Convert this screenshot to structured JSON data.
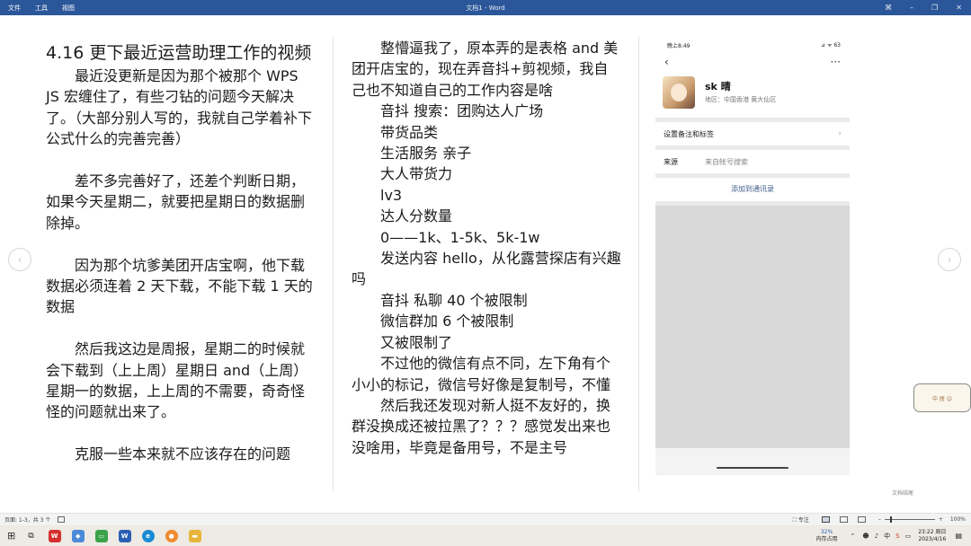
{
  "titlebar": {
    "menu": [
      "文件",
      "工具",
      "视图"
    ],
    "title": "文档1  -  Word",
    "buttons": [
      "⌘",
      "–",
      "❐",
      "✕"
    ]
  },
  "left_column": {
    "heading": "4.16  更下最近运营助理工作的视频",
    "p1": "最近没更新是因为那个被那个 WPS JS 宏缠住了，有些刁钻的问题今天解决了。（大部分别人写的，我就自己学着补下公式什么的完善完善）",
    "p2": "差不多完善好了，还差个判断日期，如果今天星期二，就要把星期日的数据删除掉。",
    "p3": "因为那个坑爹美团开店宝啊，他下载数据必须连着 2 天下载，不能下载 1 天的数据",
    "p4": "然后我这边是周报，星期二的时候就会下载到（上上周）星期日 and（上周）星期一的数据，上上周的不需要，奇奇怪怪的问题就出来了。",
    "p5": "克服一些本来就不应该存在的问题"
  },
  "middle_column": {
    "lines": [
      "整懵逼我了，原本弄的是表格 and 美团开店宝的，现在弄音抖+剪视频，我自己也不知道自己的工作内容是啥",
      "音抖  搜索：团购达人广场",
      "带货品类",
      "生活服务  亲子",
      "大人带货力",
      "lv3",
      "达人分数量",
      "0——1k、1-5k、5k-1w",
      "发送内容 hello，从化露营探店有兴趣吗",
      "音抖  私聊 40 个被限制",
      "微信群加 6 个被限制",
      "又被限制了",
      "不过他的微信有点不同，左下角有个小小的标记，微信号好像是复制号，不懂",
      "然后我还发现对新人挺不友好的，换群没换成还被拉黑了？？？感觉发出来也没啥用，毕竟是备用号，不是主号"
    ]
  },
  "phone": {
    "status_time": "晚上8:49",
    "status_right": "⊿ ᯤ 63",
    "back": "‹",
    "more": "···",
    "name": "sk 晴",
    "region": "地区：中国香港  黄大仙区",
    "remark_row": "设置备注和标签",
    "source_label": "来源",
    "source_value": "来自帐号搜索",
    "add_contact": "添加到通讯录"
  },
  "sticker_text": "中 居 ☺",
  "doc_footer": "文档结尾",
  "statusbar": {
    "pages": "页面: 1-3，共 3 个",
    "focus": "专注",
    "zoom": "100%"
  },
  "taskbar": {
    "cpu": "32%",
    "cpu_label": "内存占用",
    "ime": "中",
    "time": "23:22 周日",
    "date": "2023/4/16"
  }
}
